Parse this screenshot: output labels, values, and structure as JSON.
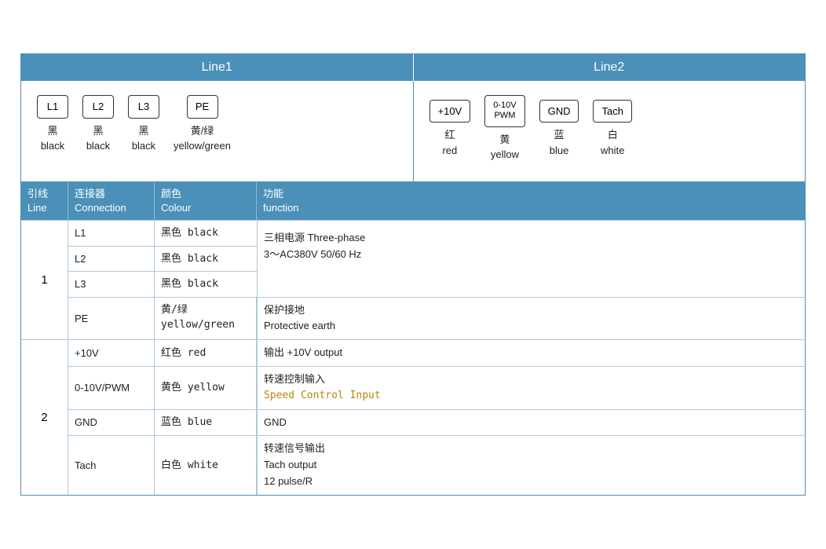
{
  "headers": {
    "line1": "Line1",
    "line2": "Line2"
  },
  "line1_connectors": [
    {
      "id": "L1",
      "label_cn": "黑",
      "label_en": "black"
    },
    {
      "id": "L2",
      "label_cn": "黑",
      "label_en": "black"
    },
    {
      "id": "L3",
      "label_cn": "黑",
      "label_en": "black"
    },
    {
      "id": "PE",
      "label_cn": "黄/绿",
      "label_en": "yellow/green"
    }
  ],
  "line2_connectors": [
    {
      "id": "+10V",
      "label_cn": "红",
      "label_en": "red"
    },
    {
      "id": "0-10V\nPWM",
      "label_cn": "黄",
      "label_en": "yellow"
    },
    {
      "id": "GND",
      "label_cn": "蓝",
      "label_en": "blue"
    },
    {
      "id": "Tach",
      "label_cn": "白",
      "label_en": "white"
    }
  ],
  "table": {
    "headers": {
      "line": "引线\nLine",
      "connection": "连接器\nConnection",
      "colour": "颜色\nColour",
      "function": "功能\nfunction"
    },
    "groups": [
      {
        "line_num": "1",
        "sub_rows": [
          {
            "conn": "L1",
            "color": "黑色 black",
            "func": "三相电源 Three-phase\n3～AC380V 50/60 Hz",
            "func_merged": true,
            "func_rows": 3
          },
          {
            "conn": "L2",
            "color": "黑色 black",
            "func": ""
          },
          {
            "conn": "L3",
            "color": "黑色 black",
            "func": ""
          }
        ],
        "pe_row": {
          "conn": "PE",
          "color_line1": "黄/绿",
          "color_line2": "yellow/green",
          "func_line1": "保护接地",
          "func_line2": "Protective earth"
        }
      },
      {
        "line_num": "2",
        "rows": [
          {
            "conn": "+10V",
            "color": "红色 red",
            "func": "输出 +10V output"
          },
          {
            "conn": "0-10V/PWM",
            "color": "黄色 yellow",
            "func_line1": "转速控制输入",
            "func_line2": "Speed Control Input",
            "is_code": true
          },
          {
            "conn": "GND",
            "color": "蓝色 blue",
            "func": "GND"
          },
          {
            "conn": "Tach",
            "color_line1": "白色 white",
            "func_line1": "转速信号输出",
            "func_line2": "Tach output",
            "func_line3": "12 pulse/R"
          }
        ]
      }
    ]
  }
}
